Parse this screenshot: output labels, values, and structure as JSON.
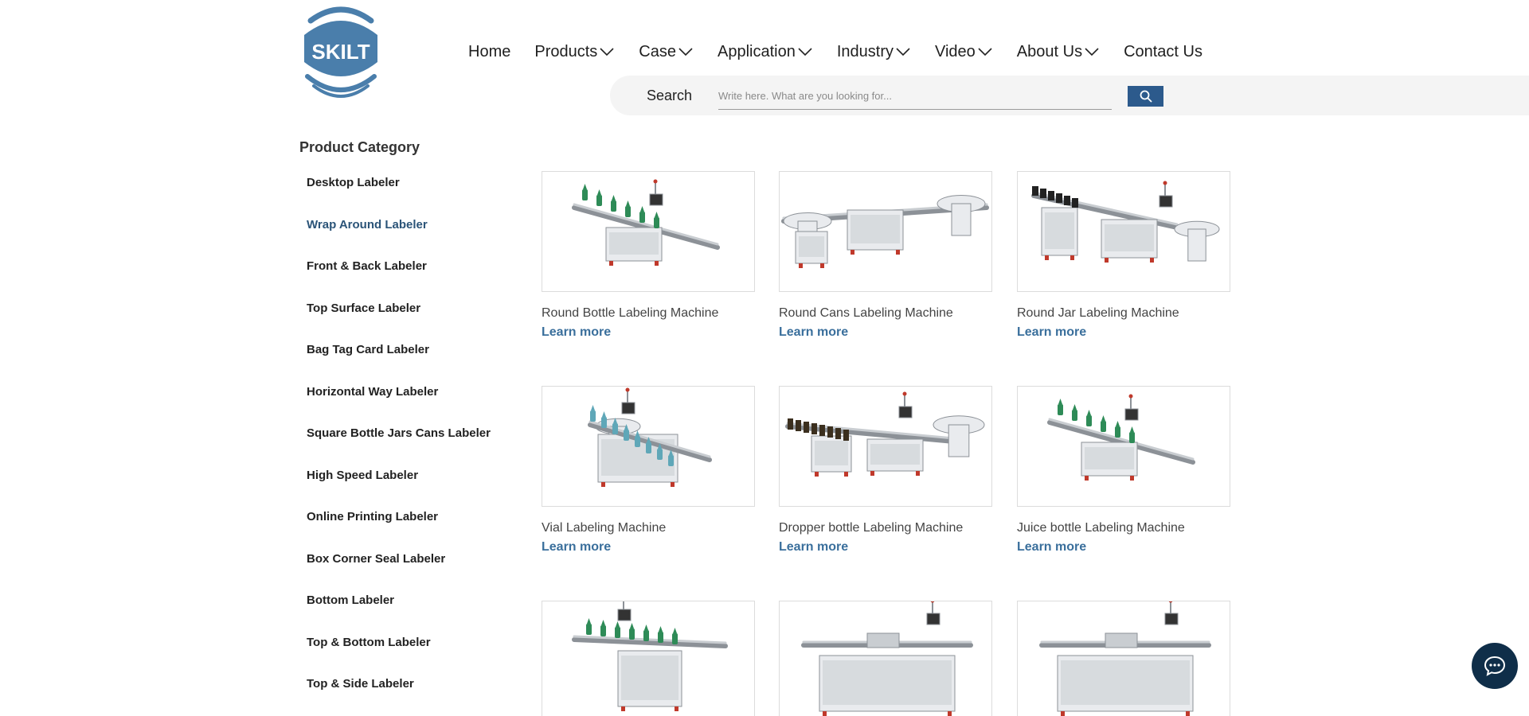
{
  "brand": {
    "logo_text": "SKILT",
    "color": "#4a7eab"
  },
  "nav": {
    "items": [
      {
        "label": "Home",
        "has_dropdown": false
      },
      {
        "label": "Products",
        "has_dropdown": true
      },
      {
        "label": "Case",
        "has_dropdown": true
      },
      {
        "label": "Application",
        "has_dropdown": true
      },
      {
        "label": "Industry",
        "has_dropdown": true
      },
      {
        "label": "Video",
        "has_dropdown": true
      },
      {
        "label": "About Us",
        "has_dropdown": true
      },
      {
        "label": "Contact Us",
        "has_dropdown": false
      }
    ]
  },
  "search": {
    "label": "Search",
    "placeholder": "Write here. What are you looking for...",
    "value": "",
    "button_icon": "search-icon",
    "button_color": "#2c5a8c"
  },
  "sidebar": {
    "title": "Product Category",
    "active_index": 1,
    "items": [
      "Desktop Labeler",
      "Wrap Around Labeler",
      "Front & Back Labeler",
      "Top Surface Labeler",
      "Bag Tag Card Labeler",
      "Horizontal Way Labeler",
      "Square Bottle Jars Cans Labeler",
      "High Speed Labeler",
      "Online Printing Labeler",
      "Box Corner Seal Labeler",
      "Bottom Labeler",
      "Top & Bottom Labeler",
      "Top & Side Labeler"
    ]
  },
  "products": [
    {
      "name": "Round Bottle Labeling Machine",
      "link": "Learn more",
      "image": "machine-bottles-green"
    },
    {
      "name": "Round Cans Labeling Machine",
      "link": "Learn more",
      "image": "machine-cans-line"
    },
    {
      "name": "Round Jar Labeling Machine",
      "link": "Learn more",
      "image": "machine-jar-line"
    },
    {
      "name": "Vial Labeling Machine",
      "link": "Learn more",
      "image": "machine-vial"
    },
    {
      "name": "Dropper bottle Labeling Machine",
      "link": "Learn more",
      "image": "machine-dropper-line"
    },
    {
      "name": "Juice bottle Labeling Machine",
      "link": "Learn more",
      "image": "machine-bottles-green"
    },
    {
      "name": "",
      "link": "",
      "image": "machine-bottles-tall"
    },
    {
      "name": "",
      "link": "",
      "image": "machine-wide"
    },
    {
      "name": "",
      "link": "",
      "image": "machine-wide"
    }
  ],
  "chat": {
    "icon": "chat-bubble-icon",
    "color": "#0f2e49"
  }
}
